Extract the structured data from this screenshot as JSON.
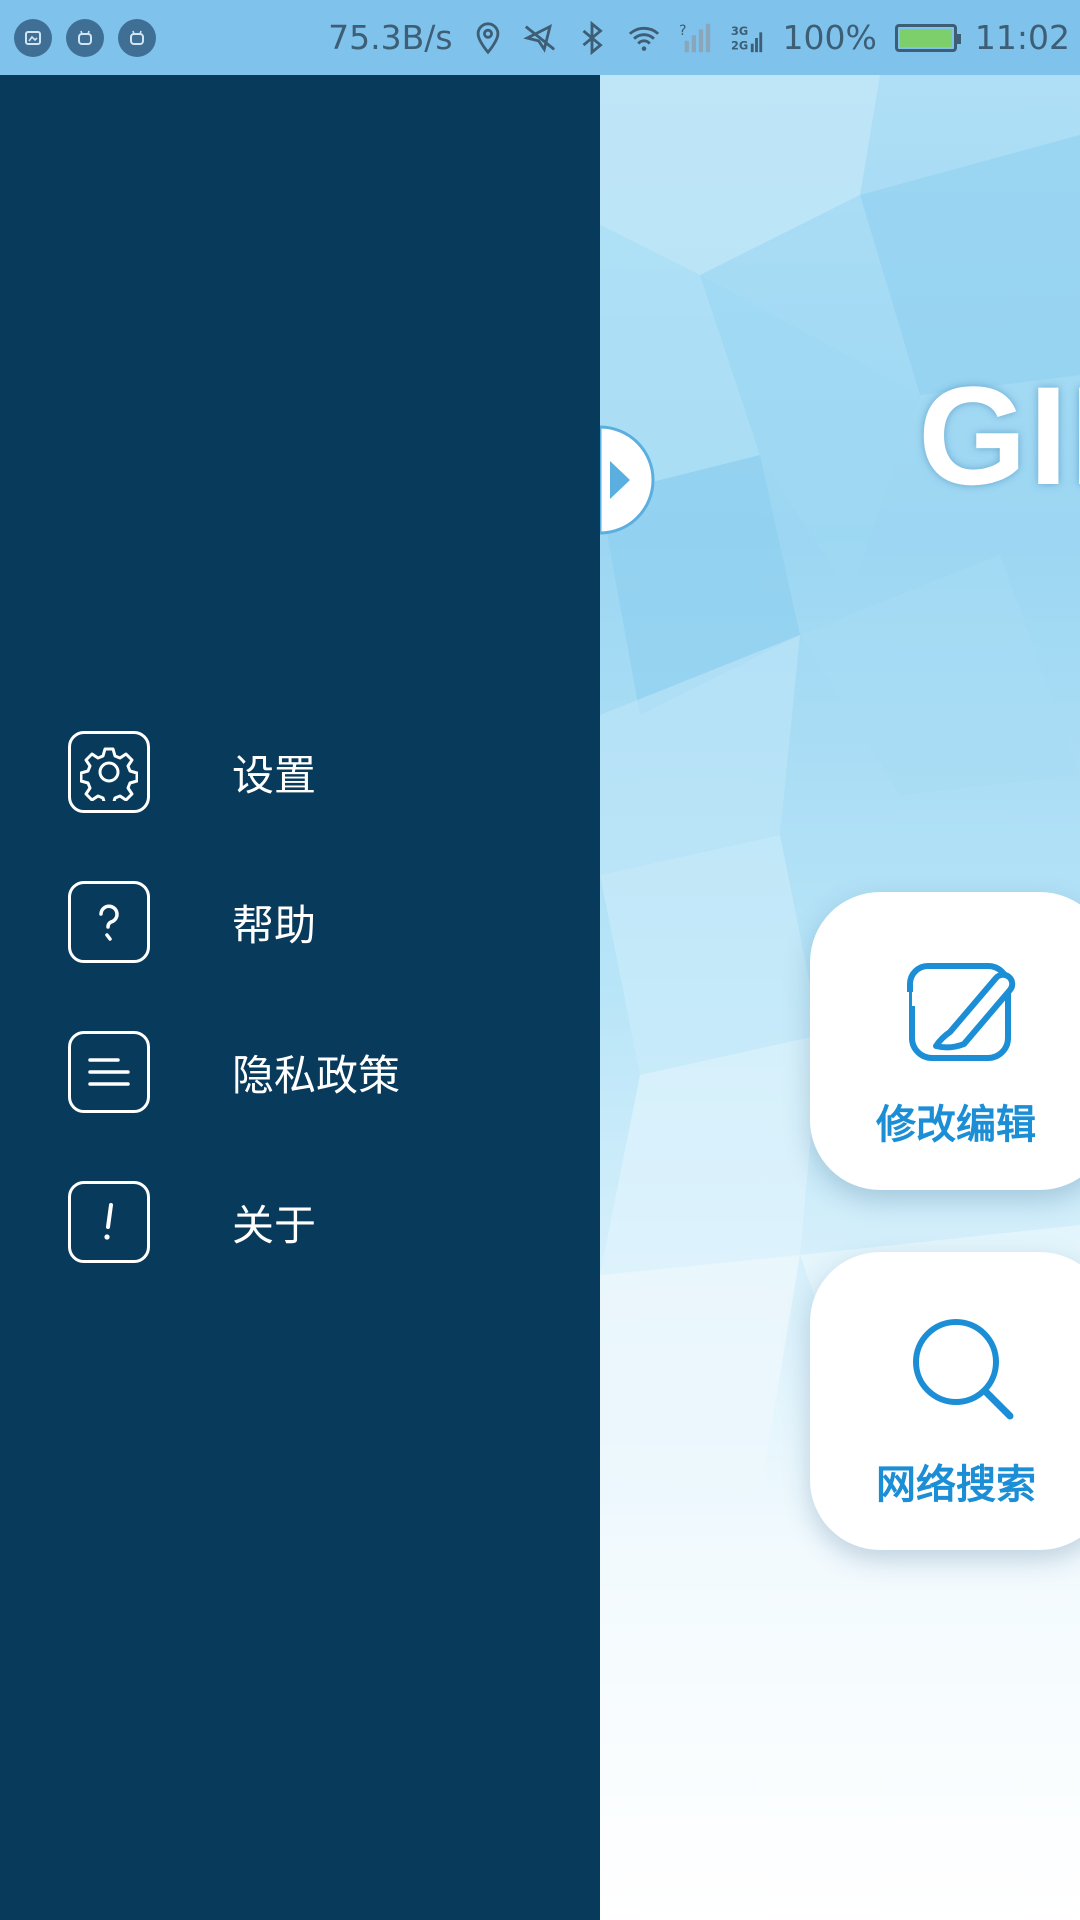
{
  "status_bar": {
    "speed": "75.3B/s",
    "network_type": "3G 2G",
    "battery_percent": "100%",
    "time": "11:02",
    "left_icons": [
      "screenshot-icon",
      "android-icon",
      "android-icon"
    ],
    "right_icons": [
      "location-icon",
      "mute-icon",
      "bluetooth-icon",
      "wifi-icon",
      "signal-icon",
      "signal-icon"
    ]
  },
  "drawer": {
    "background": "#083a5b",
    "items": [
      {
        "label": "设置",
        "icon": "gear-icon"
      },
      {
        "label": "帮助",
        "icon": "help-icon"
      },
      {
        "label": "隐私政策",
        "icon": "list-icon"
      },
      {
        "label": "关于",
        "icon": "info-icon"
      }
    ]
  },
  "main": {
    "title": "GIF",
    "cards": [
      {
        "label": "修改编辑",
        "icon": "edit-icon"
      },
      {
        "label": "网络搜索",
        "icon": "search-icon"
      }
    ],
    "accent": "#1c8ed6"
  }
}
